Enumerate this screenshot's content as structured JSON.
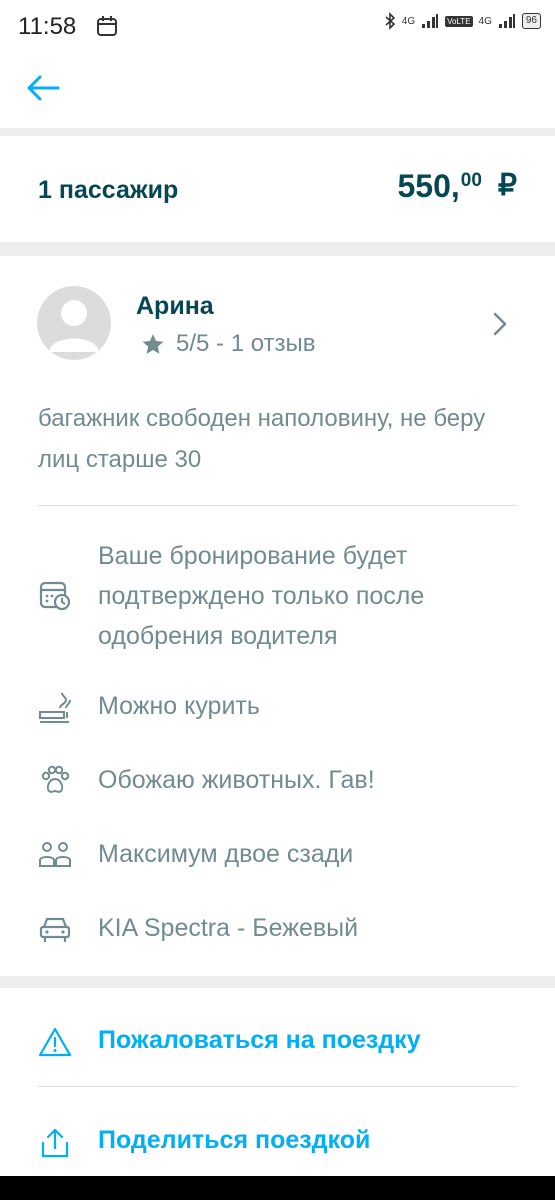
{
  "status_bar": {
    "time": "11:58",
    "net1": "4G",
    "net2": "4G",
    "volte": "VoLTE",
    "battery": "96"
  },
  "price_summary": {
    "passengers": "1 пассажир",
    "price_main": "550,",
    "price_cents": "00",
    "currency": "₽"
  },
  "driver": {
    "name": "Арина",
    "rating": "5/5 - 1 отзыв",
    "comment": "багажник свободен наполовину, не беру лиц старше 30"
  },
  "features": [
    {
      "icon": "calendar-clock-icon",
      "text": "Ваше бронирование будет подтверждено только после одобрения водителя"
    },
    {
      "icon": "smoking-icon",
      "text": "Можно курить"
    },
    {
      "icon": "paw-icon",
      "text": "Обожаю животных. Гав!"
    },
    {
      "icon": "two-persons-icon",
      "text": "Максимум двое сзади"
    },
    {
      "icon": "car-icon",
      "text": "KIA Spectra - Бежевый"
    }
  ],
  "actions": {
    "report": "Пожаловаться на поездку",
    "share": "Поделиться поездкой"
  },
  "colors": {
    "accent": "#00aff5",
    "dark_text": "#054752",
    "muted_text": "#708c91"
  }
}
